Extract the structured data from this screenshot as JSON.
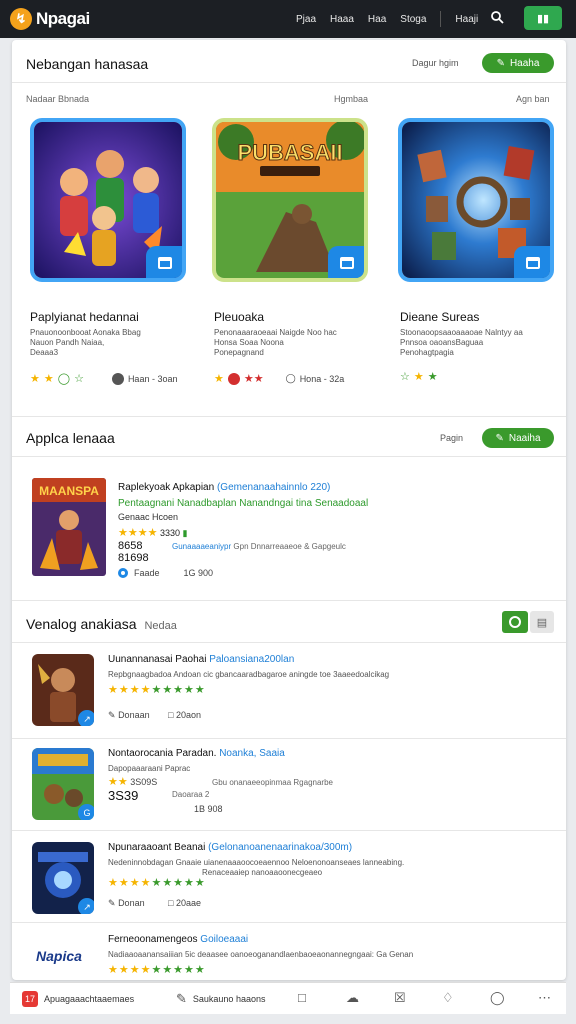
{
  "topbar": {
    "logo_glyph": "↯",
    "logo_text": "Npagai",
    "nav": [
      "Pjaa",
      "Haaa",
      "Haa",
      "Stoga",
      "Haaji"
    ],
    "search_icon": "search-icon",
    "pill_label": "▮▮"
  },
  "section1": {
    "title": "Nebangan hanasaa",
    "link": "Dagur hgim",
    "button": "Haaha",
    "subheads": [
      "Nadaar Bbnada",
      "Hgmbaa",
      "Agn ban"
    ],
    "cards": [
      {
        "title": "Paplyianat hedannai",
        "desc": [
          "Pnauonoonbooat Aonaka Bbag",
          "Nauon Pandh Naiaa,",
          "Deaaa3"
        ],
        "meta": "Haan - 3oan"
      },
      {
        "title": "Pleuoaka",
        "desc": [
          "Penonaaaraoeaai Naigde Noo  hac",
          "Honsa Soaa Noona",
          "Ponepagnand"
        ],
        "meta": "Hona - 32a"
      },
      {
        "title": "Dieane Sureas",
        "desc": [
          "Stoonaoopsaaoaaaoae Nalntyy   aa",
          "Pnnsoa oaoansBaguaa",
          "Penohagtpagia"
        ],
        "meta": ""
      }
    ],
    "card_art": [
      "heroes",
      "PUBASAII",
      "portal"
    ]
  },
  "section2": {
    "title": "Applca lenaaa",
    "link": "Pagin",
    "button": "Naaiha",
    "featured": {
      "art_label": "MAANSPA",
      "title": "Raplekyoak Apkapian",
      "title_blue": "(Gemenanaahainnlo 220)",
      "line_green": "Pentaagnani Nanadbaplan Nanandngai tina Senaadoaal",
      "line2": "Genaac Hcoen",
      "rating_value": "3330",
      "price1": "8658",
      "price2": "81698",
      "blue_text": "Gunaaaaeaniypr",
      "gray_text": "Gpn Dnnarreaaeoe & Gapgeulc",
      "footer_left": "Faade",
      "footer_right": "1G 900"
    }
  },
  "section3": {
    "title": "Venalog anakiasa",
    "title_suffix": "Nedaa",
    "rows": [
      {
        "title": "Uunannanasai Paohai",
        "title_blue": "Paloansiana200lan",
        "desc": "Repbgnaagbadoa Andoan cic gbancaaradbagaroe aningde toe 3aaeedoalcikag",
        "meta_left": "Donaan",
        "meta_right": "20aon",
        "art": "warrior"
      },
      {
        "title": "Nontaorocania Paradan.",
        "title_blue": "Noanka, Saaia",
        "desc": "Dapopaaaraani Paprac",
        "price": "3S39",
        "rating_value": "3S09S",
        "extra": "Gbu onanaeeopinmaa Rgagnarbe",
        "sub": "Daoaraa 2",
        "meta_right": "1B 908",
        "art": "arena"
      },
      {
        "title": "Npunaraaoant Beanai",
        "title_blue": "(Gelonanoanenaarinakoa/300m)",
        "desc": "Nedeninnobdagan Gnaaie uianenaaaoocoeaennoo Neloenonoanseaes lanneabing.",
        "desc2": "Renaceaaiep nanoaaoonecgeaeo",
        "meta_left": "Donan",
        "meta_right": "20aae",
        "art": "orb"
      },
      {
        "title": "Ferneoonamengeos",
        "title_blue": "Goiloeaaai",
        "desc": "Nadiaaoaanansaiiian 5ic deaasee oanoeoganandlaenbaoeaonannegngaai: Ga Genan",
        "logo": "Napica",
        "art": "logo"
      }
    ]
  },
  "bottombar": {
    "items": [
      "Apuagaaachtaaemaes",
      "Saukauno haaons"
    ],
    "icons": [
      "app-icon",
      "pencil-icon",
      "box-icon",
      "cloud-icon",
      "tag-icon",
      "pin-icon",
      "gauge-icon",
      "more-icon"
    ]
  },
  "colors": {
    "topbar": "#1c1f24",
    "accent_green": "#3a9a2c",
    "accent_blue": "#1e88e5",
    "star": "#f5b400"
  }
}
